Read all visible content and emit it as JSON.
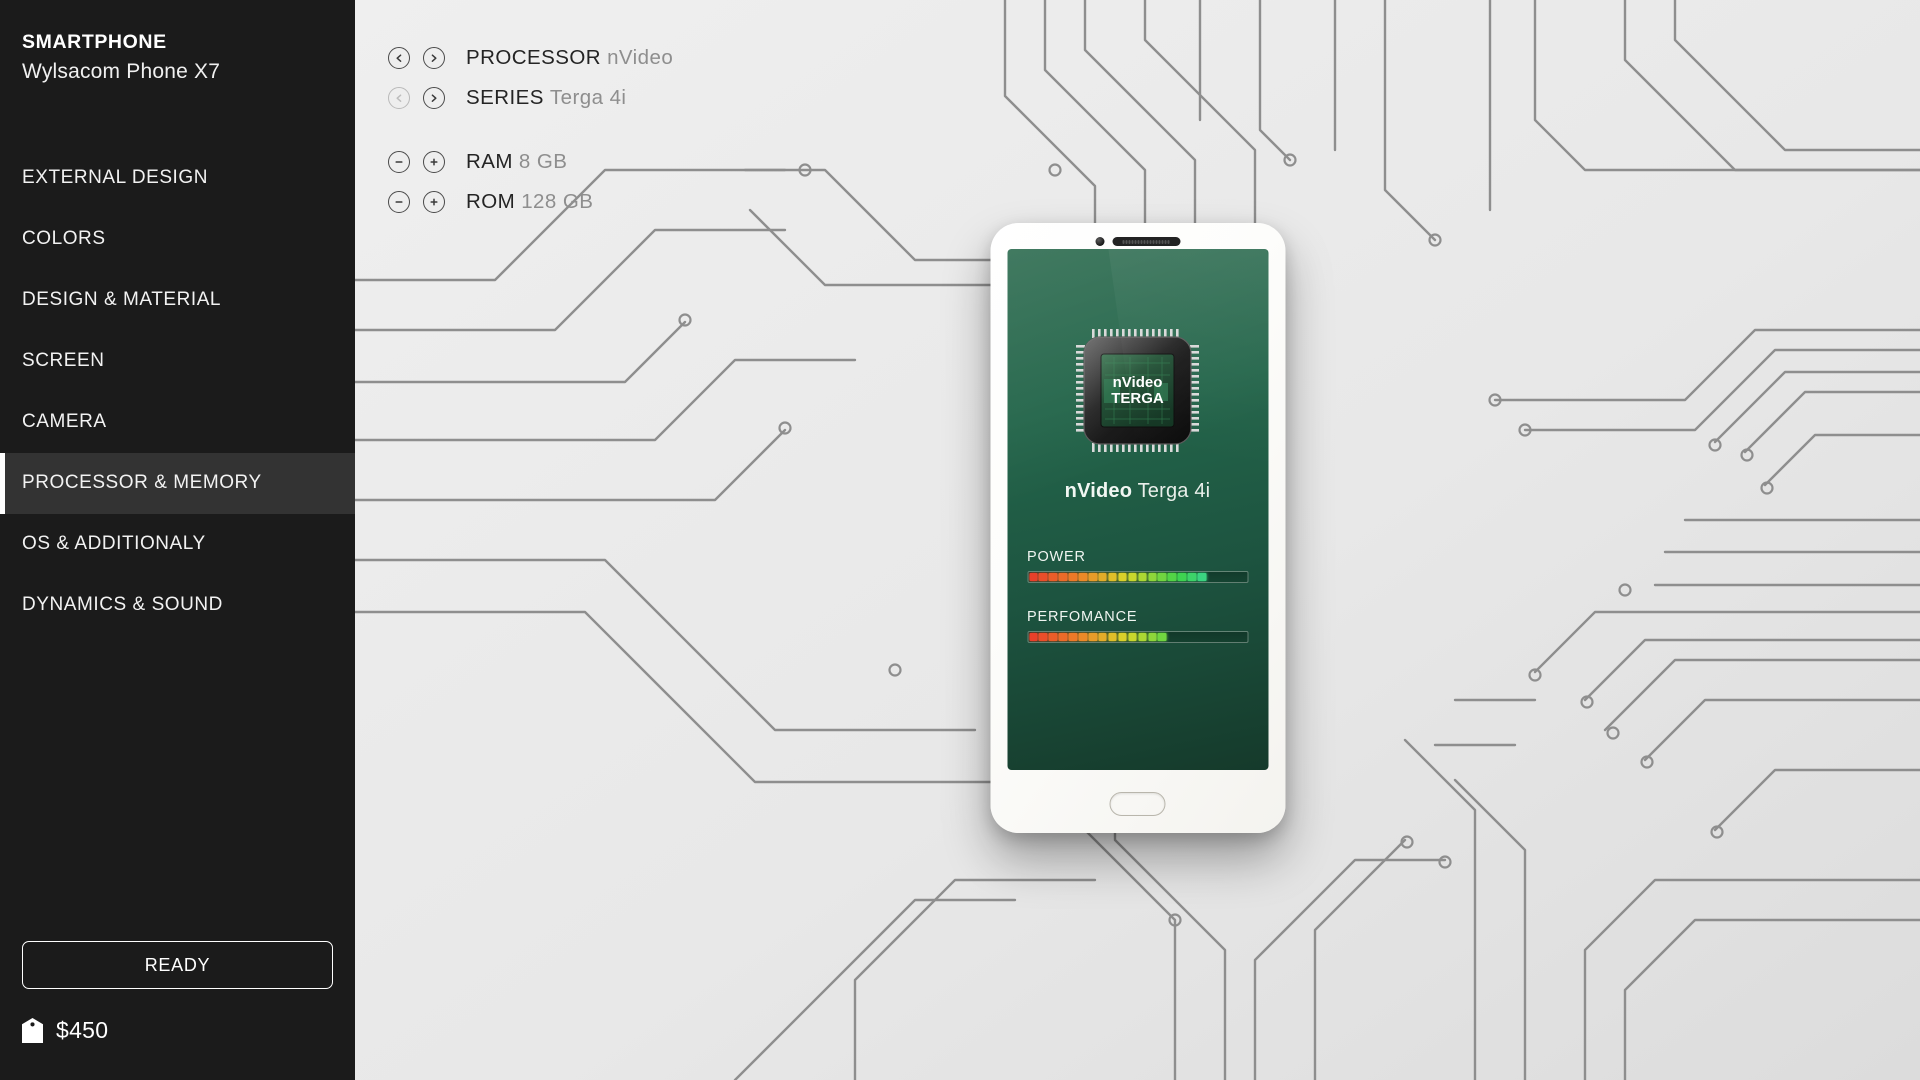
{
  "sidebar": {
    "brand": {
      "kicker": "SMARTPHONE",
      "model": "Wylsacom Phone X7"
    },
    "items": [
      {
        "label": "EXTERNAL DESIGN",
        "active": false
      },
      {
        "label": "COLORS",
        "active": false
      },
      {
        "label": "DESIGN & MATERIAL",
        "active": false
      },
      {
        "label": "SCREEN",
        "active": false
      },
      {
        "label": "CAMERA",
        "active": false
      },
      {
        "label": "PROCESSOR & MEMORY",
        "active": true
      },
      {
        "label": "OS & ADDITIONALY",
        "active": false
      },
      {
        "label": "DYNAMICS & SOUND",
        "active": false
      }
    ],
    "ready_label": "READY",
    "price": "$450",
    "price_icon": "price-tag-icon"
  },
  "options": {
    "selectors": [
      {
        "label": "PROCESSOR",
        "value": "nVideo",
        "prev_icon": "chevron-left-icon",
        "next_icon": "chevron-right-icon",
        "prev_enabled": true,
        "next_enabled": true
      },
      {
        "label": "SERIES",
        "value": "Terga 4i",
        "prev_icon": "chevron-left-icon",
        "next_icon": "chevron-right-icon",
        "prev_enabled": false,
        "next_enabled": true
      }
    ],
    "steppers": [
      {
        "label": "RAM",
        "value": "8 GB",
        "minus_icon": "minus-circle-icon",
        "plus_icon": "plus-circle-icon"
      },
      {
        "label": "ROM",
        "value": "128 GB",
        "minus_icon": "minus-circle-icon",
        "plus_icon": "plus-circle-icon"
      }
    ]
  },
  "phone": {
    "camera_icon": "front-camera-icon",
    "speaker_icon": "earpiece-speaker-icon",
    "home_button_icon": "home-button-icon",
    "chip": {
      "line1": "nVideo",
      "line2": "TERGA"
    },
    "screen_title": {
      "brand": "nVideo",
      "model": "Terga 4i"
    },
    "meters": [
      {
        "label": "POWER",
        "filled": 18,
        "total": 22
      },
      {
        "label": "PERFOMANCE",
        "filled": 14,
        "total": 22
      }
    ]
  },
  "colors": {
    "sidebar_bg": "#1b1b1b",
    "sidebar_active_bg": "#333333",
    "accent": "#ffffff",
    "main_bg": "#e9e9e9",
    "trace": "#8e8e8e",
    "screen_green_top": "#2c6b4f",
    "screen_green_bottom": "#153a2b",
    "meter_low": "#e8402a",
    "meter_mid": "#d8d82a",
    "meter_high": "#3fd34a",
    "meter_top": "#33d2e0"
  }
}
